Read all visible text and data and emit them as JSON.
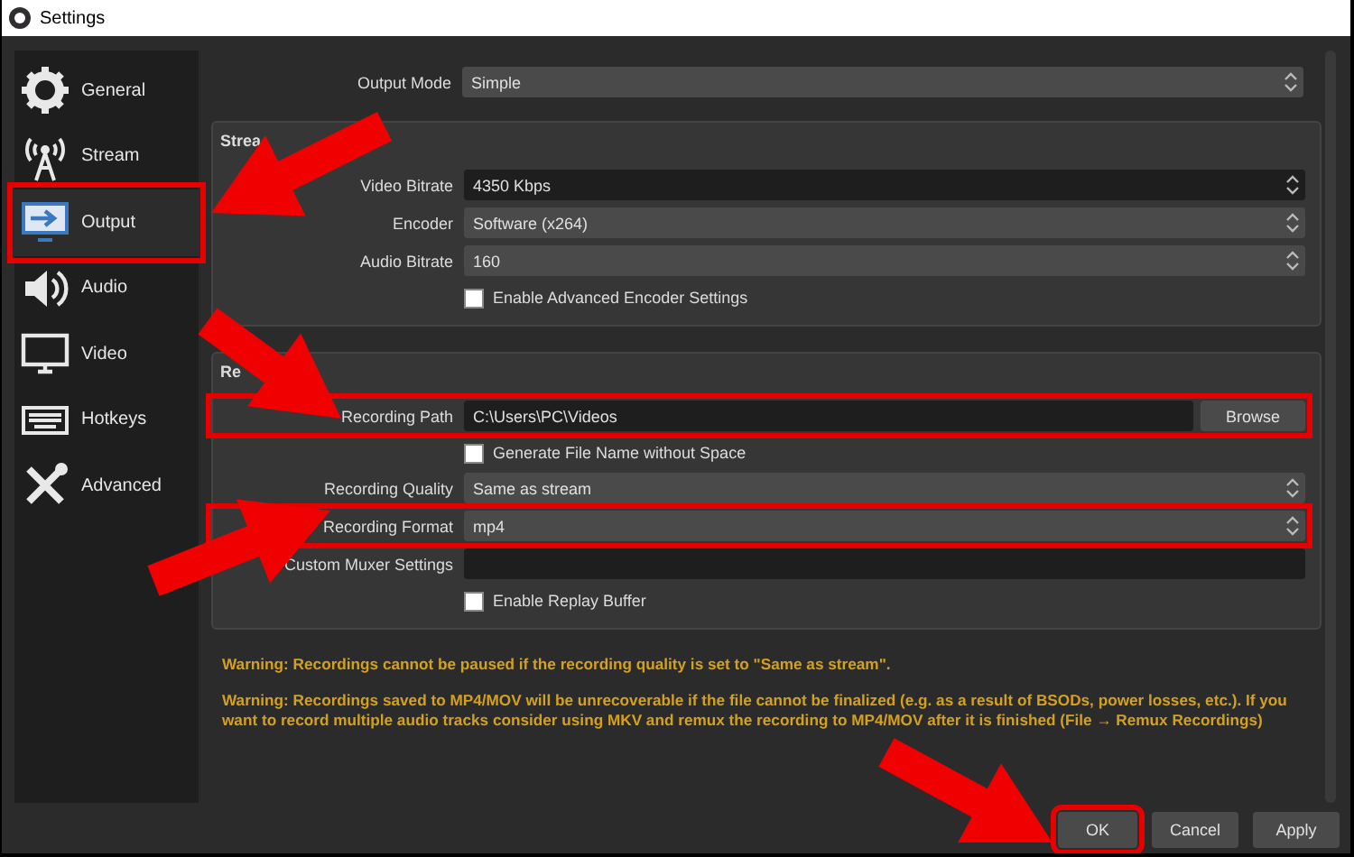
{
  "window": {
    "title": "Settings"
  },
  "sidebar": {
    "items": [
      {
        "label": "General",
        "selected": false,
        "highlighted": false
      },
      {
        "label": "Stream",
        "selected": false,
        "highlighted": false
      },
      {
        "label": "Output",
        "selected": true,
        "highlighted": true
      },
      {
        "label": "Audio",
        "selected": false,
        "highlighted": false
      },
      {
        "label": "Video",
        "selected": false,
        "highlighted": false
      },
      {
        "label": "Hotkeys",
        "selected": false,
        "highlighted": false
      },
      {
        "label": "Advanced",
        "selected": false,
        "highlighted": false
      }
    ]
  },
  "output_mode": {
    "label": "Output Mode",
    "value": "Simple"
  },
  "groups": [
    {
      "title": "Strea",
      "rows": [
        {
          "kind": "spin",
          "label": "Video Bitrate",
          "value": "4350 Kbps",
          "highlighted": false
        },
        {
          "kind": "combo",
          "label": "Encoder",
          "value": "Software (x264)",
          "highlighted": false
        },
        {
          "kind": "combo",
          "label": "Audio Bitrate",
          "value": "160",
          "highlighted": false
        },
        {
          "kind": "checkbox",
          "label": "Enable Advanced Encoder Settings",
          "checked": false
        }
      ]
    },
    {
      "title": "Re",
      "rows": [
        {
          "kind": "path",
          "label": "Recording Path",
          "value": "C:\\Users\\PC\\Videos",
          "button": "Browse",
          "highlighted": true
        },
        {
          "kind": "checkbox",
          "label": "Generate File Name without Space",
          "checked": false
        },
        {
          "kind": "combo",
          "label": "Recording Quality",
          "value": "Same as stream",
          "highlighted": false
        },
        {
          "kind": "combo",
          "label": "Recording Format",
          "value": "mp4",
          "highlighted": true
        },
        {
          "kind": "text",
          "label": "Custom Muxer Settings",
          "highlighted": false
        },
        {
          "kind": "checkbox",
          "label": "Enable Replay Buffer",
          "checked": false
        }
      ]
    }
  ],
  "warnings": [
    "Warning: Recordings cannot be paused if the recording quality is set to \"Same as stream\".",
    "Warning: Recordings saved to MP4/MOV will be unrecoverable if the file cannot be finalized (e.g. as a result of BSODs, power losses, etc.). If you want to record multiple audio tracks consider using MKV and remux the recording to MP4/MOV after it is finished (File → Remux Recordings)"
  ],
  "buttons": [
    {
      "label": "OK",
      "highlighted": true
    },
    {
      "label": "Cancel",
      "highlighted": false
    },
    {
      "label": "Apply",
      "highlighted": false
    }
  ]
}
